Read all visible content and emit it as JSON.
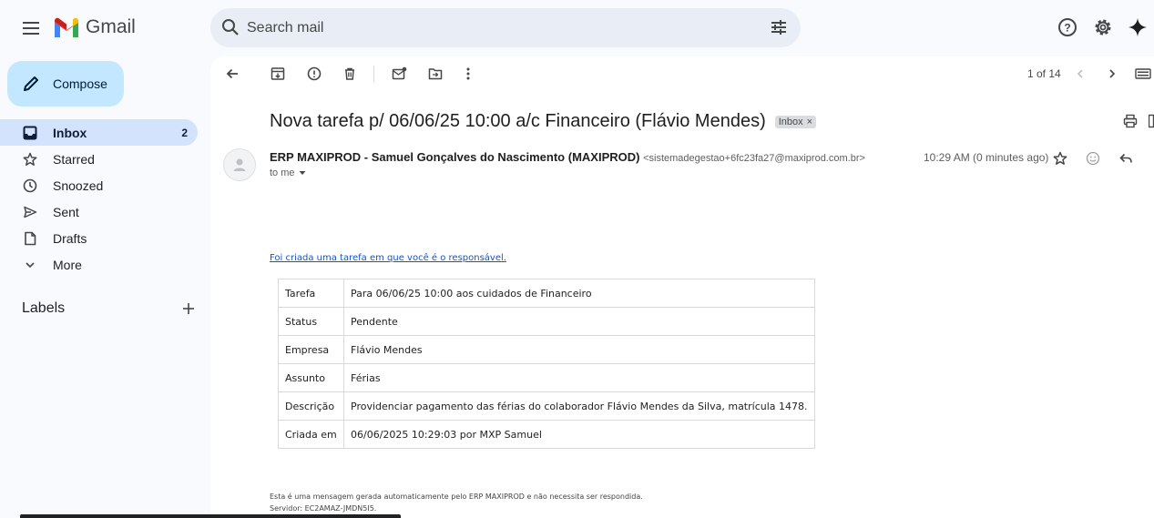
{
  "app": {
    "name": "Gmail"
  },
  "search": {
    "placeholder": "Search mail"
  },
  "compose": {
    "label": "Compose"
  },
  "nav": [
    {
      "label": "Inbox",
      "count": "2",
      "icon": "inbox-icon"
    },
    {
      "label": "Starred",
      "count": "",
      "icon": "star-icon"
    },
    {
      "label": "Snoozed",
      "count": "",
      "icon": "clock-icon"
    },
    {
      "label": "Sent",
      "count": "",
      "icon": "send-icon"
    },
    {
      "label": "Drafts",
      "count": "",
      "icon": "draft-icon"
    },
    {
      "label": "More",
      "count": "",
      "icon": "chevron-down-icon"
    }
  ],
  "labels": {
    "title": "Labels"
  },
  "pager": {
    "text": "1 of 14"
  },
  "email": {
    "subject": "Nova tarefa p/ 06/06/25 10:00 a/c Financeiro (Flávio Mendes)",
    "tag": "Inbox",
    "sender_name": "ERP MAXIPROD - Samuel Gonçalves do Nascimento (MAXIPROD)",
    "sender_email": "<sistemadegestao+6fc23fa27@maxiprod.com.br>",
    "to": "to me",
    "time": "10:29 AM (0 minutes ago)",
    "link_text": "Foi criada uma tarefa em que você é o responsável.",
    "rows": [
      {
        "k": "Tarefa",
        "v": "Para 06/06/25 10:00 aos cuidados de Financeiro"
      },
      {
        "k": "Status",
        "v": "Pendente"
      },
      {
        "k": "Empresa",
        "v": "Flávio Mendes"
      },
      {
        "k": "Assunto",
        "v": "Férias"
      },
      {
        "k": "Descrição",
        "v": "Providenciar pagamento das férias do colaborador Flávio Mendes da Silva, matrícula 1478."
      },
      {
        "k": "Criada em",
        "v": "06/06/2025 10:29:03 por MXP Samuel"
      }
    ],
    "footer_line1": "Esta é uma mensagem gerada automaticamente pelo ERP MAXIPROD e não necessita ser respondida.",
    "footer_line2": "Servidor: EC2AMAZ-JMDN5I5."
  },
  "colors": {
    "accent": "#c2e7ff",
    "active_nav": "#d3e3fd",
    "link": "#1155cc"
  }
}
